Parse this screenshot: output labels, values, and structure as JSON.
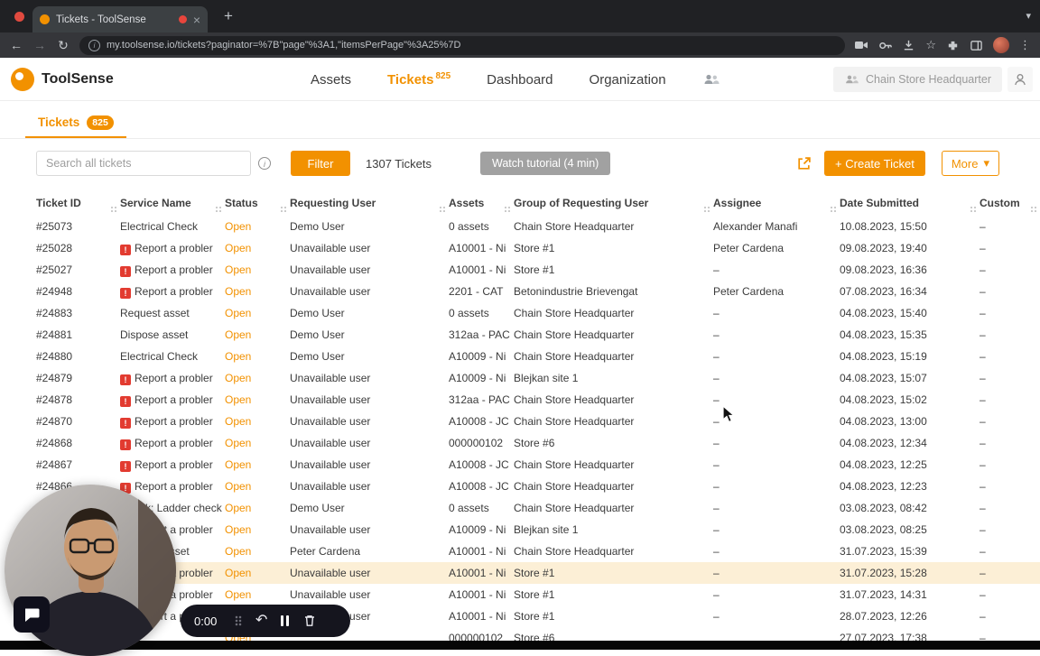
{
  "browser": {
    "tab_title": "Tickets - ToolSense",
    "url": "my.toolsense.io/tickets?paginator=%7B\"page\"%3A1,\"itemsPerPage\"%3A25%7D"
  },
  "icons": {
    "back": "←",
    "forward": "→",
    "reload": "↻",
    "new_tab": "+",
    "close_tab": "×",
    "chevron_down": "▾",
    "menu_kebab": "⋮",
    "star": "☆",
    "info": "i",
    "undo": "↶"
  },
  "header": {
    "brand": "ToolSense",
    "nav": {
      "assets": "Assets",
      "tickets": "Tickets",
      "tickets_badge": "825",
      "dashboard": "Dashboard",
      "organization": "Organization"
    },
    "org_selector": "Chain Store Headquarter"
  },
  "page_tab": {
    "label": "Tickets",
    "badge": "825"
  },
  "actions": {
    "search_placeholder": "Search all tickets",
    "filter": "Filter",
    "count": "1307 Tickets",
    "tutorial": "Watch tutorial (4 min)",
    "create": "+ Create Ticket",
    "more": "More"
  },
  "recorder": {
    "timer": "0:00"
  },
  "colors": {
    "accent": "#F29100",
    "status_open": "#F29100",
    "row_highlight": "#FCEFD6",
    "alert": "#E23B30"
  },
  "table": {
    "columns": [
      "Ticket ID",
      "Service Name",
      "Status",
      "Requesting User",
      "Assets",
      "Group of Requesting User",
      "Assignee",
      "Date Submitted",
      "Custom"
    ],
    "rows": [
      {
        "id": "#25073",
        "alert": false,
        "service": "Electrical Check",
        "status": "Open",
        "user": "Demo User",
        "asset": "0 assets",
        "group": "Chain Store Headquarter",
        "assignee": "Alexander Manafi",
        "date": "10.08.2023, 15:50",
        "custom": "–",
        "highlight": false
      },
      {
        "id": "#25028",
        "alert": true,
        "service": "Report a probler",
        "status": "Open",
        "user": "Unavailable user",
        "asset": "A10001 - Ni",
        "group": "Store #1",
        "assignee": "Peter Cardena",
        "date": "09.08.2023, 19:40",
        "custom": "–",
        "highlight": false
      },
      {
        "id": "#25027",
        "alert": true,
        "service": "Report a probler",
        "status": "Open",
        "user": "Unavailable user",
        "asset": "A10001 - Ni",
        "group": "Store #1",
        "assignee": "–",
        "date": "09.08.2023, 16:36",
        "custom": "–",
        "highlight": false
      },
      {
        "id": "#24948",
        "alert": true,
        "service": "Report a probler",
        "status": "Open",
        "user": "Unavailable user",
        "asset": "2201 - CAT",
        "group": "Betonindustrie Brievengat",
        "assignee": "Peter Cardena",
        "date": "07.08.2023, 16:34",
        "custom": "–",
        "highlight": false
      },
      {
        "id": "#24883",
        "alert": false,
        "service": "Request asset",
        "status": "Open",
        "user": "Demo User",
        "asset": "0 assets",
        "group": "Chain Store Headquarter",
        "assignee": "–",
        "date": "04.08.2023, 15:40",
        "custom": "–",
        "highlight": false
      },
      {
        "id": "#24881",
        "alert": false,
        "service": "Dispose asset",
        "status": "Open",
        "user": "Demo User",
        "asset": "312aa - PAC",
        "group": "Chain Store Headquarter",
        "assignee": "–",
        "date": "04.08.2023, 15:35",
        "custom": "–",
        "highlight": false
      },
      {
        "id": "#24880",
        "alert": false,
        "service": "Electrical Check",
        "status": "Open",
        "user": "Demo User",
        "asset": "A10009 - Ni",
        "group": "Chain Store Headquarter",
        "assignee": "–",
        "date": "04.08.2023, 15:19",
        "custom": "–",
        "highlight": false
      },
      {
        "id": "#24879",
        "alert": true,
        "service": "Report a probler",
        "status": "Open",
        "user": "Unavailable user",
        "asset": "A10009 - Ni",
        "group": "Blejkan site 1",
        "assignee": "–",
        "date": "04.08.2023, 15:07",
        "custom": "–",
        "highlight": false
      },
      {
        "id": "#24878",
        "alert": true,
        "service": "Report a probler",
        "status": "Open",
        "user": "Unavailable user",
        "asset": "312aa - PAC",
        "group": "Chain Store Headquarter",
        "assignee": "–",
        "date": "04.08.2023, 15:02",
        "custom": "–",
        "highlight": false
      },
      {
        "id": "#24870",
        "alert": true,
        "service": "Report a probler",
        "status": "Open",
        "user": "Unavailable user",
        "asset": "A10008 - JC",
        "group": "Chain Store Headquarter",
        "assignee": "–",
        "date": "04.08.2023, 13:00",
        "custom": "–",
        "highlight": false
      },
      {
        "id": "#24868",
        "alert": true,
        "service": "Report a probler",
        "status": "Open",
        "user": "Unavailable user",
        "asset": "000000102",
        "group": "Store #6",
        "assignee": "–",
        "date": "04.08.2023, 12:34",
        "custom": "–",
        "highlight": false
      },
      {
        "id": "#24867",
        "alert": true,
        "service": "Report a probler",
        "status": "Open",
        "user": "Unavailable user",
        "asset": "A10008 - JC",
        "group": "Chain Store Headquarter",
        "assignee": "–",
        "date": "04.08.2023, 12:25",
        "custom": "–",
        "highlight": false
      },
      {
        "id": "#24866",
        "alert": true,
        "service": "Report a probler",
        "status": "Open",
        "user": "Unavailable user",
        "asset": "A10008 - JC",
        "group": "Chain Store Headquarter",
        "assignee": "–",
        "date": "04.08.2023, 12:23",
        "custom": "–",
        "highlight": false
      },
      {
        "id": "",
        "alert": false,
        "service": "Check: Ladder check",
        "status": "Open",
        "user": "Demo User",
        "asset": "0 assets",
        "group": "Chain Store Headquarter",
        "assignee": "–",
        "date": "03.08.2023, 08:42",
        "custom": "–",
        "highlight": false
      },
      {
        "id": "",
        "alert": true,
        "service": "Report a probler",
        "status": "Open",
        "user": "Unavailable user",
        "asset": "A10009 - Ni",
        "group": "Blejkan site 1",
        "assignee": "–",
        "date": "03.08.2023, 08:25",
        "custom": "–",
        "highlight": false
      },
      {
        "id": "",
        "alert": false,
        "service": "Request asset",
        "status": "Open",
        "user": "Peter Cardena",
        "asset": "A10001 - Ni",
        "group": "Chain Store Headquarter",
        "assignee": "–",
        "date": "31.07.2023, 15:39",
        "custom": "–",
        "highlight": false
      },
      {
        "id": "",
        "alert": true,
        "service": "Report a probler",
        "status": "Open",
        "user": "Unavailable user",
        "asset": "A10001 - Ni",
        "group": "Store #1",
        "assignee": "–",
        "date": "31.07.2023, 15:28",
        "custom": "–",
        "highlight": true
      },
      {
        "id": "",
        "alert": true,
        "service": "Report a probler",
        "status": "Open",
        "user": "Unavailable user",
        "asset": "A10001 - Ni",
        "group": "Store #1",
        "assignee": "–",
        "date": "31.07.2023, 14:31",
        "custom": "–",
        "highlight": false
      },
      {
        "id": "",
        "alert": true,
        "service": "Report a probler",
        "status": "Open",
        "user": "Unavailable user",
        "asset": "A10001 - Ni",
        "group": "Store #1",
        "assignee": "–",
        "date": "28.07.2023, 12:26",
        "custom": "–",
        "highlight": false
      },
      {
        "id": "",
        "alert": false,
        "service": "",
        "status": "Open",
        "user": "",
        "asset": "000000102",
        "group": "Store #6",
        "assignee": "",
        "date": "27.07.2023, 17:38",
        "custom": "–",
        "highlight": false
      }
    ]
  }
}
